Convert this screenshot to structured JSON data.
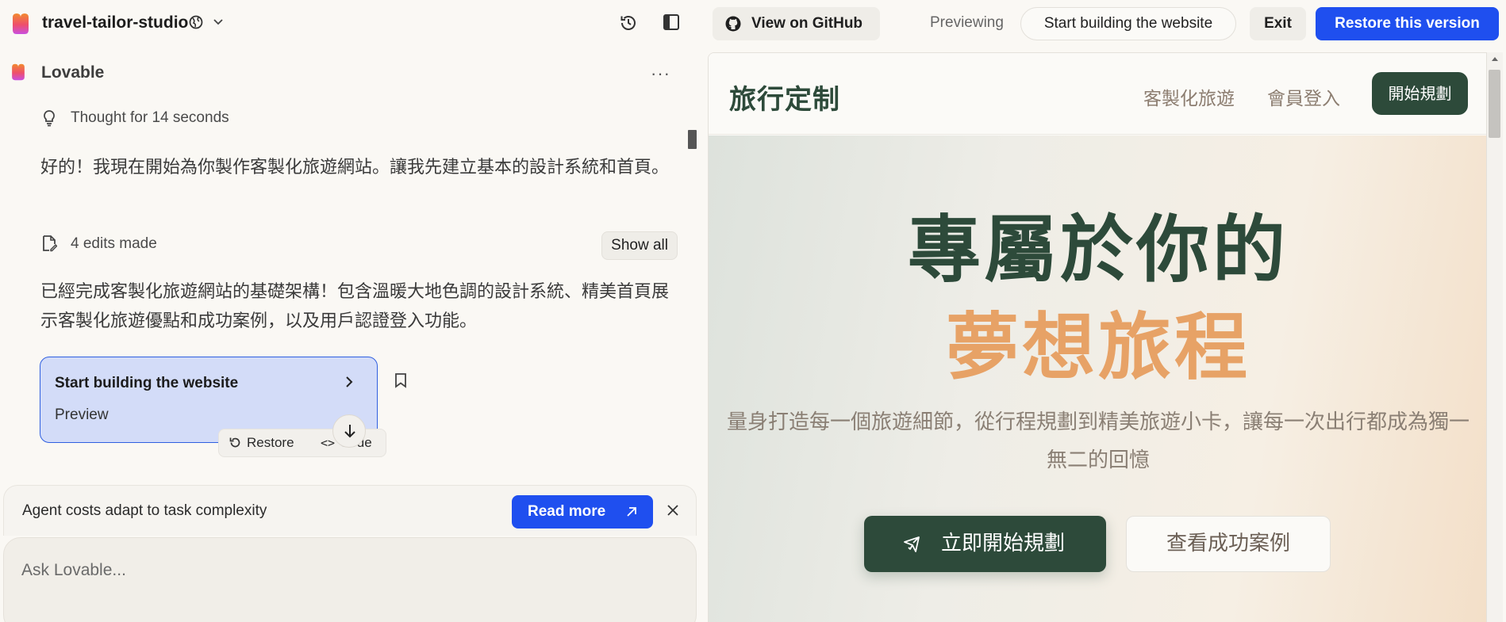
{
  "app": {
    "project_name": "travel-tailor-studio",
    "brand_colors": {
      "heart_top": "#f28a2e",
      "heart_bottom": "#d94bd0",
      "accent_blue": "#1f4fef"
    }
  },
  "chat": {
    "agent_name": "Lovable",
    "thought_text": "Thought for 14 seconds",
    "message1": "好的！我現在開始為你製作客製化旅遊網站。讓我先建立基本的設計系統和首頁。",
    "edits_text": "4 edits made",
    "show_all_label": "Show all",
    "message2": "已經完成客製化旅遊網站的基礎架構！包含溫暖大地色調的設計系統、精美首頁展示客製化旅遊優點和成功案例，以及用戶認證登入功能。",
    "version_card": {
      "title": "Start building the website",
      "subtitle": "Preview"
    },
    "restore_label": "Restore",
    "code_label": "Code",
    "notice": {
      "text": "Agent costs adapt to task complexity",
      "read_more_label": "Read more"
    },
    "composer_placeholder": "Ask Lovable..."
  },
  "preview_bar": {
    "github_label": "View on GitHub",
    "previewing_label": "Previewing",
    "version_name": "Start building the website",
    "exit_label": "Exit",
    "restore_version_label": "Restore this version"
  },
  "site": {
    "brand": "旅行定制",
    "nav_links": [
      "客製化旅遊",
      "會員登入"
    ],
    "nav_cta": "開始規劃",
    "hero_line1": "專屬於你的",
    "hero_line2": "夢想旅程",
    "hero_sub": "量身打造每一個旅遊細節，從行程規劃到精美旅遊小卡，讓每一次出行都成為獨一無二的回憶",
    "cta_primary": "立即開始規劃",
    "cta_secondary": "查看成功案例",
    "colors": {
      "forest": "#2d4a3a",
      "amber": "#e7a266"
    }
  }
}
